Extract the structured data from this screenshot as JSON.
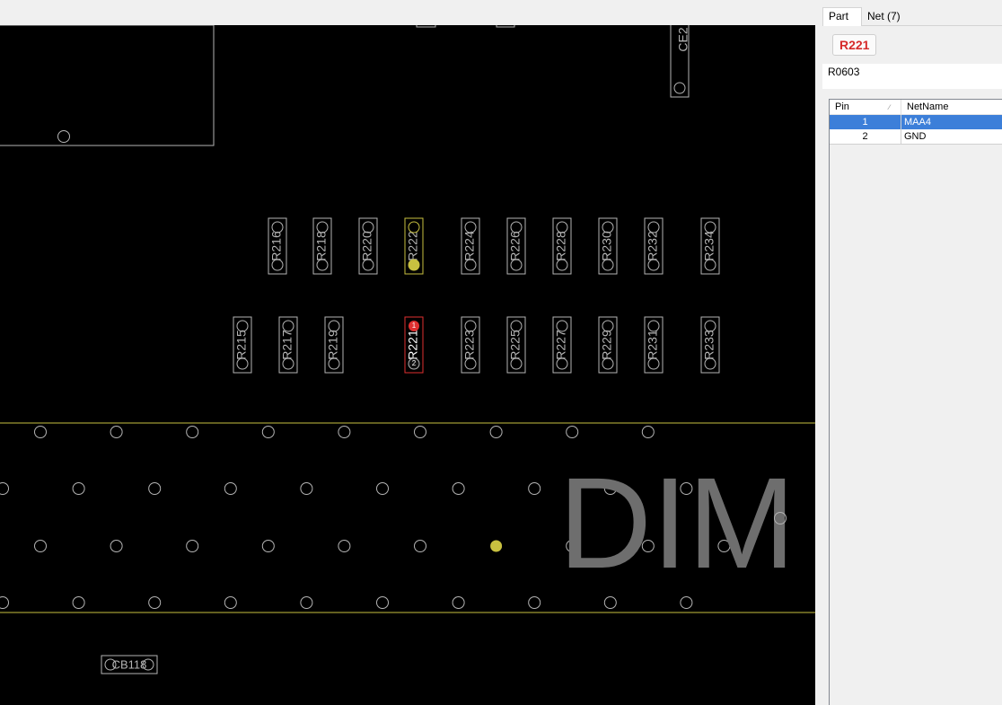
{
  "board": {
    "silkscreen_text": "DIM",
    "component_labels": {
      "top_row": [
        "R216",
        "R218",
        "R220",
        "R222",
        "R224",
        "R226",
        "R228",
        "R230",
        "R232",
        "R234"
      ],
      "bottom_row": [
        "R215",
        "R217",
        "R219",
        "R221",
        "R223",
        "R225",
        "R227",
        "R229",
        "R231",
        "R233"
      ],
      "other": [
        "CE2",
        "CB118"
      ]
    },
    "selected_component": "R221",
    "selected_pin_numbers": [
      "1",
      "2"
    ],
    "colors": {
      "background": "#000000",
      "outline": "#b4b4b4",
      "highlight": "#c8c040",
      "selection": "#e03030",
      "silkscreen": "#6e6e6e"
    }
  },
  "panel": {
    "tabs": [
      {
        "label": "Part",
        "active": true
      },
      {
        "label": "Net (7)",
        "active": false
      }
    ],
    "part_name": "R221",
    "footprint": "R0603",
    "grid": {
      "columns": [
        "Pin",
        "NetName"
      ],
      "rows": [
        {
          "pin": "1",
          "net": "MAA4",
          "selected": true
        },
        {
          "pin": "2",
          "net": "GND",
          "selected": false
        }
      ]
    }
  }
}
